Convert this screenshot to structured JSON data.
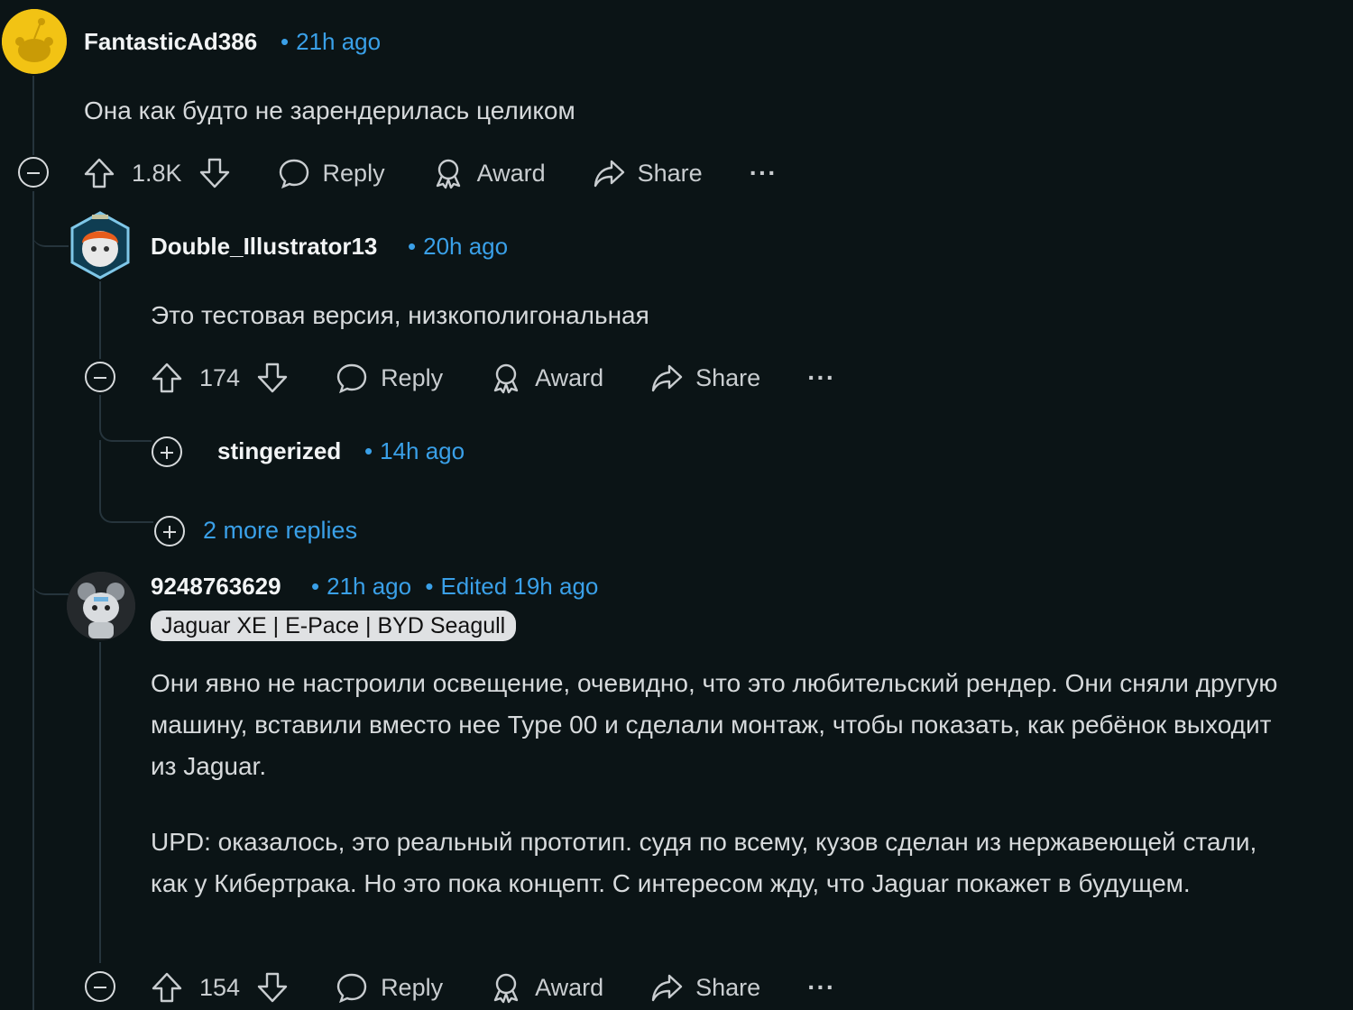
{
  "comments": [
    {
      "username": "FantasticAd386",
      "time": "21h ago",
      "body": "Она как будто не зарендерилась целиком",
      "votes": "1.8K"
    },
    {
      "username": "Double_Illustrator13",
      "time": "20h ago",
      "body": "Это тестовая версия, низкополигональная",
      "votes": "174"
    },
    {
      "username": "stingerized",
      "time": "14h ago"
    },
    {
      "username": "9248763629",
      "time": "21h ago",
      "edited": "Edited 19h ago",
      "flair": "Jaguar XE | E-Pace | BYD Seagull",
      "body_p1": "Они явно не настроили освещение, очевидно, что это любительский рендер. Они сняли другую машину, вставили вместо нее Type 00 и сделали монтаж, чтобы показать, как ребёнок выходит из Jaguar.",
      "body_p2": "UPD: оказалось, это реальный прототип. судя по всему, кузов сделан из нержавеющей стали, как у Кибертрака. Но это пока концепт. С интересом жду, что Jaguar покажет в будущем.",
      "votes": "154"
    }
  ],
  "more_replies": "2 more replies",
  "actions": {
    "reply": "Reply",
    "award": "Award",
    "share": "Share",
    "overflow": "···",
    "bullet": "•"
  },
  "colors": {
    "background": "#0b1416",
    "link": "#3aa0e8",
    "thread_line": "#26343c"
  }
}
